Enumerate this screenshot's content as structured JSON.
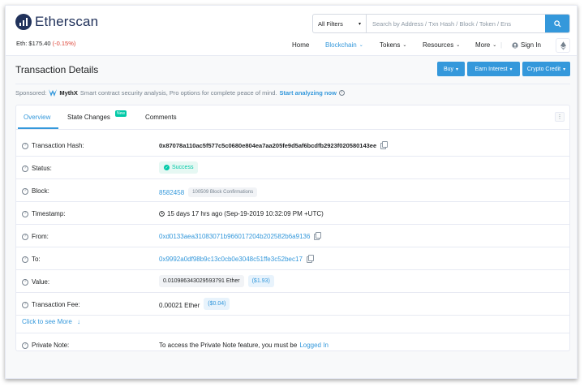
{
  "header": {
    "logo_text": "Etherscan",
    "price_label": "Eth: $175.40",
    "price_change": "(-0.15%)",
    "search": {
      "filter_label": "All Filters",
      "placeholder": "Search by Address / Txn Hash / Block / Token / Ens"
    },
    "nav": {
      "home": "Home",
      "blockchain": "Blockchain",
      "tokens": "Tokens",
      "resources": "Resources",
      "more": "More",
      "sign_in": "Sign In"
    }
  },
  "page": {
    "title": "Transaction Details",
    "buttons": {
      "buy": "Buy",
      "earn": "Earn Interest",
      "crypto": "Crypto Credit"
    },
    "sponsored": {
      "label": "Sponsored:",
      "brand": "MythX",
      "text": "Smart contract security analysis, Pro options for complete peace of mind.",
      "cta": "Start analyzing now"
    }
  },
  "tabs": {
    "overview": "Overview",
    "state_changes": "State Changes",
    "new_badge": "New",
    "comments": "Comments"
  },
  "details": {
    "hash_label": "Transaction Hash:",
    "hash_value": "0x87078a110ac5f577c5c0680e804ea7aa205fe9d5af6bcdfb2923f020580143ee",
    "status_label": "Status:",
    "status_value": "Success",
    "block_label": "Block:",
    "block_value": "8582458",
    "block_confirmations": "100509 Block Confirmations",
    "timestamp_label": "Timestamp:",
    "timestamp_value": "15 days 17 hrs ago (Sep-19-2019 10:32:09 PM +UTC)",
    "from_label": "From:",
    "from_value": "0xd0133aea31083071b966017204b202582b6a9136",
    "to_label": "To:",
    "to_value": "0x9992a0df98b9c13c0cb0e3048c51ffe3c52bec17",
    "value_label": "Value:",
    "value_value": "0.010986343029593791 Ether",
    "value_usd": "($1.93)",
    "fee_label": "Transaction Fee:",
    "fee_value": "0.00021 Ether",
    "fee_usd": "($0.04)",
    "click_more": "Click to see More",
    "note_label": "Private Note:",
    "note_text": "To access the Private Note feature, you must be",
    "note_link": "Logged In"
  },
  "colors": {
    "accent": "#3498db",
    "success": "#00c9a7",
    "negative": "#de4437",
    "brand_dark": "#21325b"
  }
}
